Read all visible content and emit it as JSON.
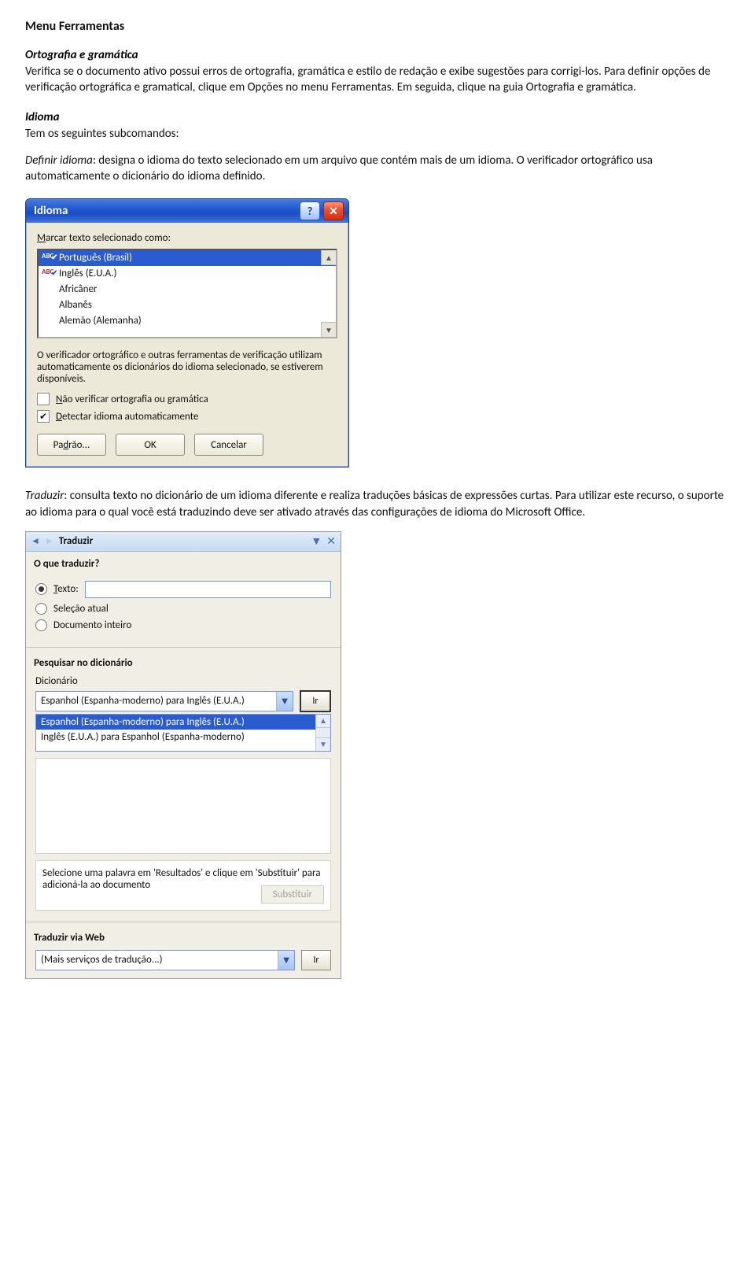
{
  "doc": {
    "title": "Menu Ferramentas",
    "sec1_title": "Ortografia e gramática",
    "sec1_p": "Verifica se o documento ativo possui erros de ortografia, gramática e estilo de redação e exibe sugestões para corrigi-los. Para definir opções de verificação ortográfica e gramatical, clique em Opções no menu Ferramentas. Em seguida, clique na guia Ortografia e gramática.",
    "sec2_title": "Idioma",
    "sec2_intro": "Tem os seguintes subcomandos:",
    "sec2_def_label": "Definir idioma",
    "sec2_def_text": ": designa o idioma do texto selecionado em um arquivo que contém mais de um idioma. O verificador ortográfico usa automaticamente o dicionário do idioma definido.",
    "sec3_def_label": "Traduzir",
    "sec3_text": ": consulta texto no dicionário de um idioma diferente e realiza traduções básicas de expressões curtas. Para utilizar este recurso, o suporte ao idioma para o qual você está traduzindo deve ser ativado através das configurações de idioma do Microsoft Office."
  },
  "dlg1": {
    "title": "Idioma",
    "mark_label": "Marcar texto selecionado como:",
    "items": [
      "Português (Brasil)",
      "Inglês (E.U.A.)",
      "Africâner",
      "Albanês",
      "Alemão (Alemanha)"
    ],
    "info": "O verificador ortográfico e outras ferramentas de verificação utilizam automaticamente os dicionários do idioma selecionado, se estiverem disponíveis.",
    "chk1_pre": "N",
    "chk1_rest": "ão verificar ortografia ou gramática",
    "chk2_pre": "D",
    "chk2_rest": "etectar idioma automaticamente",
    "btn_default_pre": "Pa",
    "btn_default_u": "d",
    "btn_default_post": "rão...",
    "btn_ok": "OK",
    "btn_cancel": "Cancelar"
  },
  "pane": {
    "title": "Traduzir",
    "q_title": "O que traduzir?",
    "r_text_pre": "T",
    "r_text_rest": "exto:",
    "r_sel": "Seleção atual",
    "r_doc": "Documento inteiro",
    "dict_title": "Pesquisar no dicionário",
    "dict_label": "Dicionário",
    "combo_value": "Espanhol (Espanha-moderno) para Inglês (E.U.A.)",
    "ir": "Ir",
    "list0": "Espanhol (Espanha-moderno) para Inglês (E.U.A.)",
    "list1": "Inglês (E.U.A.) para Espanhol (Espanha-moderno)",
    "hint": "Selecione uma palavra em 'Resultados' e clique em 'Substituir' para adicioná-la ao documento",
    "sub": "Substituir",
    "web_title": "Traduzir via Web",
    "web_combo": "(Mais serviços de tradução...)"
  }
}
